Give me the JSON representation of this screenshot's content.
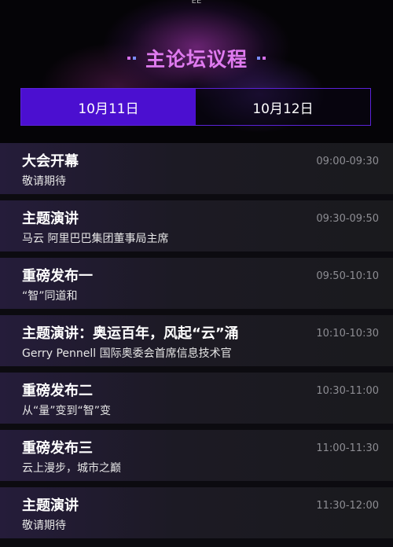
{
  "header": {
    "top_text": "EE",
    "title": "主论坛议程",
    "accent": "#e07bf0"
  },
  "tabs": [
    {
      "label": "10月11日",
      "active": true
    },
    {
      "label": "10月12日",
      "active": false
    }
  ],
  "agenda": [
    {
      "title": "大会开幕",
      "subtitle": "敬请期待",
      "time": "09:00-09:30"
    },
    {
      "title": "主题演讲",
      "subtitle": "马云 阿里巴巴集团董事局主席",
      "time": "09:30-09:50"
    },
    {
      "title": "重磅发布一",
      "subtitle": "“智”同道和",
      "time": "09:50-10:10"
    },
    {
      "title": "主题演讲：奥运百年，风起“云”涌",
      "subtitle": "Gerry Pennell 国际奥委会首席信息技术官",
      "time": "10:10-10:30"
    },
    {
      "title": "重磅发布二",
      "subtitle": "从“量”变到“智”变",
      "time": "10:30-11:00"
    },
    {
      "title": "重磅发布三",
      "subtitle": "云上漫步，城市之巅",
      "time": "11:00-11:30"
    },
    {
      "title": "主题演讲",
      "subtitle": "敬请期待",
      "time": "11:30-12:00"
    }
  ]
}
